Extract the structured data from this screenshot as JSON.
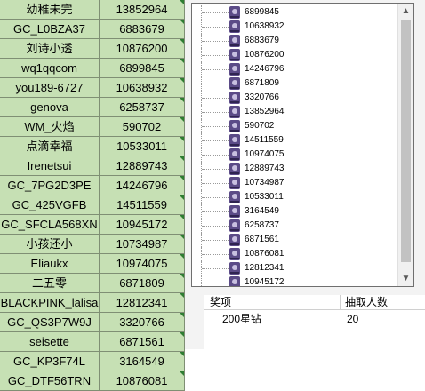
{
  "spreadsheet": {
    "rows": [
      {
        "name": "幼稚未完",
        "id": "13852964"
      },
      {
        "name": "GC_L0BZA37",
        "id": "6883679"
      },
      {
        "name": "刘诗小透",
        "id": "10876200"
      },
      {
        "name": "wq1qqcom",
        "id": "6899845"
      },
      {
        "name": "you189-6727",
        "id": "10638932"
      },
      {
        "name": "genova",
        "id": "6258737"
      },
      {
        "name": "WM_火焰",
        "id": "590702"
      },
      {
        "name": "点滴幸福",
        "id": "10533011"
      },
      {
        "name": "Irenetsui",
        "id": "12889743"
      },
      {
        "name": "GC_7PG2D3PE",
        "id": "14246796"
      },
      {
        "name": "GC_425VGFB",
        "id": "14511559"
      },
      {
        "name": "GC_SFCLA568XN",
        "id": "10945172"
      },
      {
        "name": "小孩还小",
        "id": "10734987"
      },
      {
        "name": "Eliaukx",
        "id": "10974075"
      },
      {
        "name": "二五零",
        "id": "6871809"
      },
      {
        "name": "BLACKPINK_lalisa",
        "id": "12812341"
      },
      {
        "name": "GC_QS3P7W9J",
        "id": "3320766"
      },
      {
        "name": "seisette",
        "id": "6871561"
      },
      {
        "name": "GC_KP3F74L",
        "id": "3164549"
      },
      {
        "name": "GC_DTF56TRN",
        "id": "10876081"
      }
    ]
  },
  "dropdown": {
    "items": [
      "6899845",
      "10638932",
      "6883679",
      "10876200",
      "14246796",
      "6871809",
      "3320766",
      "13852964",
      "590702",
      "14511559",
      "10974075",
      "12889743",
      "10734987",
      "10533011",
      "3164549",
      "6258737",
      "6871561",
      "10876081",
      "12812341",
      "10945172"
    ],
    "scroll_up_glyph": "▲",
    "scroll_down_glyph": "▼"
  },
  "prize_table": {
    "header_prize": "奖项",
    "header_count": "抽取人数",
    "rows": [
      {
        "prize": "200星钻",
        "count": "20"
      }
    ]
  },
  "colors": {
    "cell_green": "#c6e0b4",
    "comment_marker": "#2e7d32",
    "icon_purple": "#5b4b87"
  }
}
